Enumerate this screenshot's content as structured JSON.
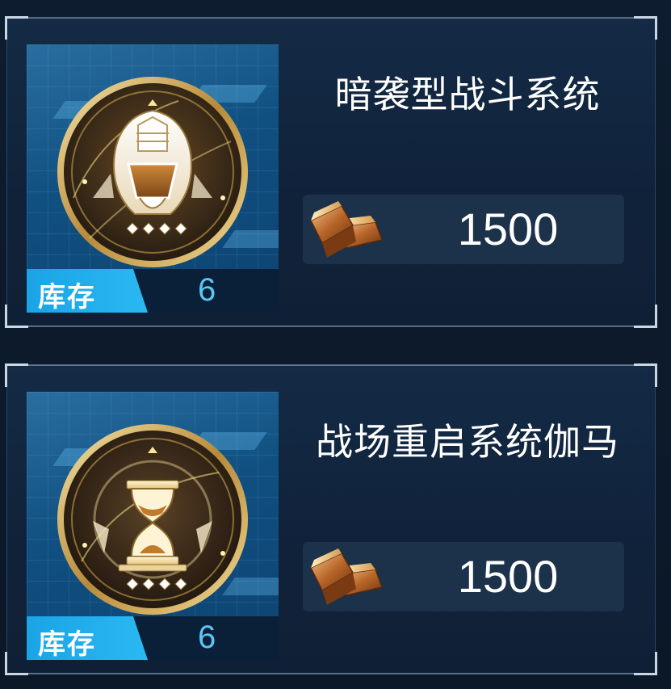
{
  "items": [
    {
      "title": "暗袭型战斗系统",
      "stock_label": "库存",
      "stock_count": "6",
      "price": "1500",
      "icon": "assassin-helmet-icon",
      "currency_icon": "gold-bar-icon"
    },
    {
      "title": "战场重启系统伽马",
      "stock_label": "库存",
      "stock_count": "6",
      "price": "1500",
      "icon": "hourglass-icon",
      "currency_icon": "gold-bar-icon"
    }
  ],
  "colors": {
    "accent": "#2ab8f2",
    "count_text": "#5cc6f5",
    "card_bg": "#142a45",
    "emblem_gold": "#c9a24a"
  }
}
